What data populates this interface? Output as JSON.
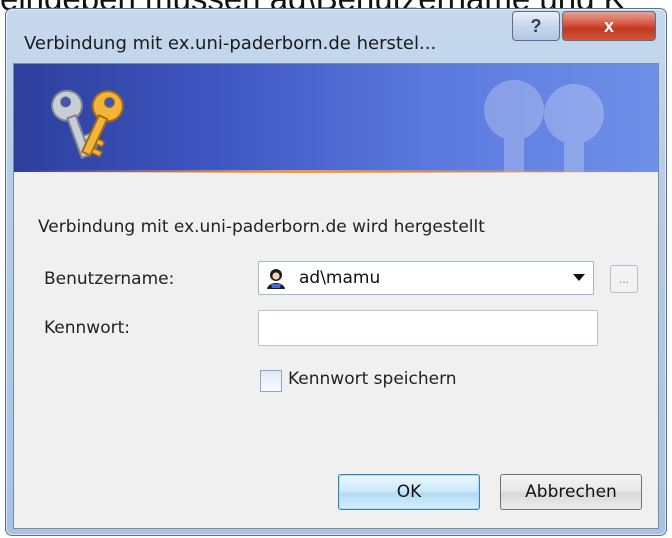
{
  "background_caption": "eingeben müssen ad\\Benutzername und K",
  "window": {
    "title": "Verbindung mit ex.uni-paderborn.de herstel...",
    "help_label": "?",
    "close_label": "x"
  },
  "dialog": {
    "message": "Verbindung mit ex.uni-paderborn.de wird hergestellt",
    "username_label": "Benutzername:",
    "username_value": "ad\\mamu",
    "browse_label": "...",
    "password_label": "Kennwort:",
    "password_value": "",
    "remember_label": "Kennwort speichern",
    "remember_checked": false,
    "ok_label": "OK",
    "cancel_label": "Abbrechen"
  },
  "colors": {
    "banner_dark": "#2c3f9c",
    "banner_light": "#6f90e8",
    "accent_line": "#f39a3c",
    "close_button": "#d5533b"
  },
  "icons": {
    "banner": "keys-icon",
    "username": "user-avatar-icon",
    "dropdown": "chevron-down-icon"
  }
}
